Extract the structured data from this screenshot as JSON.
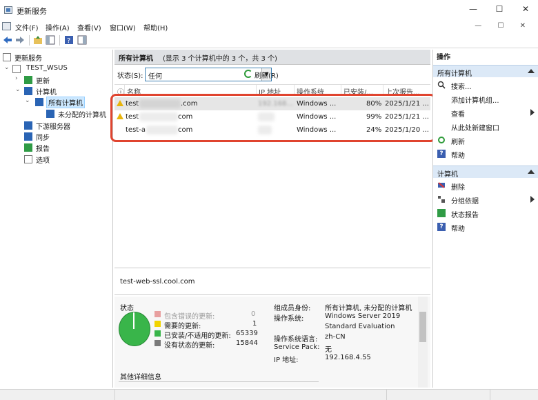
{
  "window": {
    "title": "更新服务",
    "controls": {
      "minimize": "—",
      "maximize": "☐",
      "close": "✕"
    }
  },
  "menu": [
    {
      "label": "文件(F)"
    },
    {
      "label": "操作(A)"
    },
    {
      "label": "查看(V)"
    },
    {
      "label": "窗口(W)"
    },
    {
      "label": "帮助(H)"
    }
  ],
  "mdi_controls": "— ☐ ✕",
  "tree": {
    "root": "更新服务",
    "server": "TEST_WSUS",
    "updates": "更新",
    "computers": "计算机",
    "all_computers": "所有计算机",
    "unassigned": "未分配的计算机",
    "downstream": "下游服务器",
    "sync": "同步",
    "reports": "报告",
    "options": "选项"
  },
  "center": {
    "title": "所有计算机",
    "summary": "(显示 3 个计算机中的 3 个，共 3 个)",
    "filter": {
      "label": "状态(S):",
      "value": "任何",
      "refresh": "刷新(R)"
    },
    "columns": [
      "名称",
      "IP 地址",
      "操作系统",
      "已安装/...",
      "上次报告..."
    ],
    "rows": [
      {
        "name_prefix": "test",
        "name_suffix": ".com",
        "ip": "192.168...",
        "os": "Windows ...",
        "installed": "80%",
        "last_report": "2025/1/21 ...",
        "warning": true
      },
      {
        "name_prefix": "test",
        "name_suffix": "com",
        "ip": "",
        "os": "Windows ...",
        "installed": "99%",
        "last_report": "2025/1/21 ...",
        "warning": true
      },
      {
        "name_prefix": "test-a",
        "name_suffix": "com",
        "ip": "",
        "os": "Windows ...",
        "installed": "24%",
        "last_report": "2025/1/20 ...",
        "warning": false
      }
    ],
    "selected_computer": "test-web-ssl.cool.com",
    "status": {
      "title": "状态",
      "legend": [
        {
          "label": "包含错误的更新:",
          "value": "0",
          "color": "#e8a0a0"
        },
        {
          "label": "需要的更新:",
          "value": "1",
          "color": "#f1d400"
        },
        {
          "label": "已安装/不适用的更新:",
          "value": "65339",
          "color": "#39b54a"
        },
        {
          "label": "没有状态的更新:",
          "value": "15844",
          "color": "#7a7a7a"
        }
      ],
      "other_details": "其他详细信息"
    },
    "properties": [
      {
        "label": "组成员身份:",
        "value": "所有计算机, 未分配的计算机"
      },
      {
        "label": "操作系统:",
        "value": "Windows Server 2019"
      },
      {
        "label": "",
        "value": "Standard Evaluation"
      },
      {
        "label": "操作系统语言:",
        "value": "zh-CN"
      },
      {
        "label": "Service Pack:",
        "value": "无"
      },
      {
        "label": "IP 地址:",
        "value": "192.168.4.55"
      }
    ]
  },
  "actions": {
    "title": "操作",
    "section1": "所有计算机",
    "items1": [
      "搜索...",
      "添加计算机组...",
      "查看",
      "从此处新建窗口",
      "刷新",
      "帮助"
    ],
    "section2": "计算机",
    "items2": [
      "删除",
      "分组依据",
      "状态报告",
      "帮助"
    ]
  }
}
